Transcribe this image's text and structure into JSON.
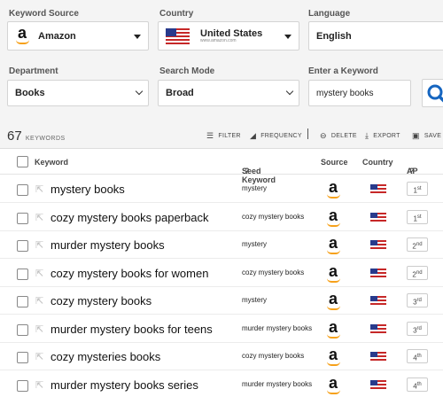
{
  "filters": {
    "keyword_source": {
      "label": "Keyword Source",
      "value": "Amazon",
      "icon": "amazon-icon"
    },
    "country": {
      "label": "Country",
      "value": "United States",
      "sub": "www.amazon.com",
      "icon": "us-flag-icon"
    },
    "language": {
      "label": "Language",
      "value": "English"
    },
    "department": {
      "label": "Department",
      "value": "Books"
    },
    "search_mode": {
      "label": "Search Mode",
      "value": "Broad"
    },
    "keyword": {
      "label": "Enter a Keyword",
      "value": "mystery books",
      "icon": "search-icon"
    }
  },
  "toolbar": {
    "count": "67",
    "count_label": "KEYWORDS",
    "filter": "FILTER",
    "frequency": "FREQUENCY",
    "delete": "DELETE",
    "export": "EXPORT",
    "save": "SAVE"
  },
  "table": {
    "headers": {
      "keyword": "Keyword",
      "seed": "Seed Keyword",
      "source": "Source",
      "country": "Country",
      "ap": "AP"
    },
    "rows": [
      {
        "keyword": "mystery books",
        "seed": "mystery",
        "ap": "1",
        "ap_sup": "st"
      },
      {
        "keyword": "cozy mystery books paperback",
        "seed": "cozy mystery books",
        "ap": "1",
        "ap_sup": "st"
      },
      {
        "keyword": "murder mystery books",
        "seed": "mystery",
        "ap": "2",
        "ap_sup": "nd"
      },
      {
        "keyword": "cozy mystery books for women",
        "seed": "cozy mystery books",
        "ap": "2",
        "ap_sup": "nd"
      },
      {
        "keyword": "cozy mystery books",
        "seed": "mystery",
        "ap": "3",
        "ap_sup": "rd"
      },
      {
        "keyword": "murder mystery books for teens",
        "seed": "murder mystery books",
        "ap": "3",
        "ap_sup": "rd"
      },
      {
        "keyword": "cozy mysteries books",
        "seed": "cozy mystery books",
        "ap": "4",
        "ap_sup": "th"
      },
      {
        "keyword": "murder mystery books series",
        "seed": "murder mystery books",
        "ap": "4",
        "ap_sup": "th"
      }
    ]
  },
  "colors": {
    "accent": "#1565c0",
    "amazon_orange": "#f6a11a"
  }
}
